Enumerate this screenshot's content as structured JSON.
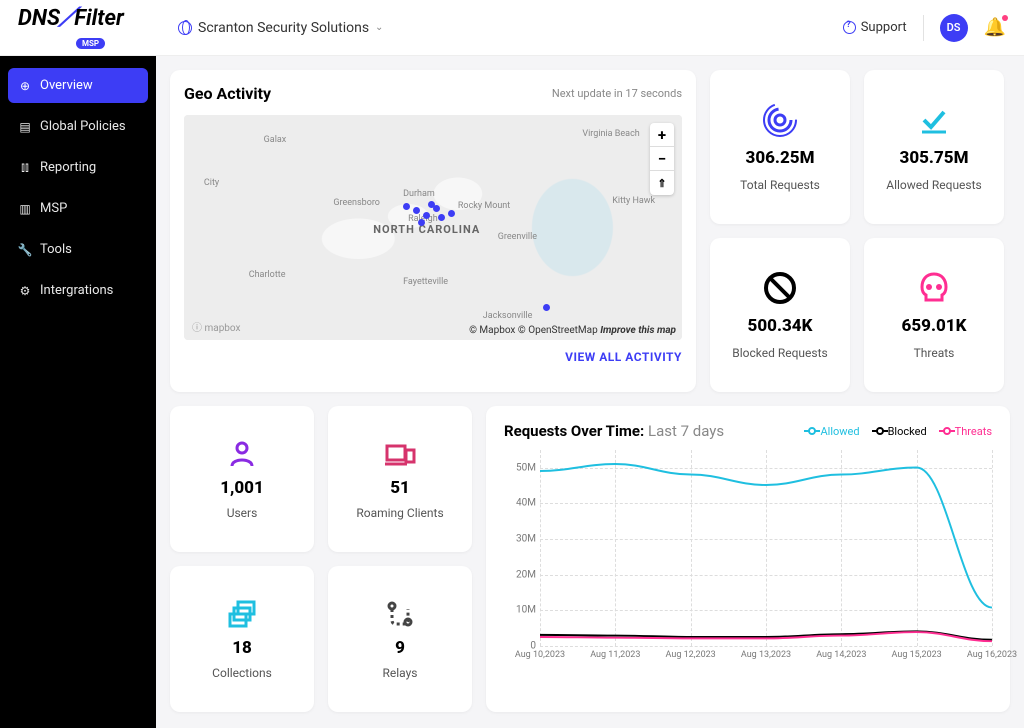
{
  "topbar": {
    "logo_dns": "DNS",
    "logo_filter": "Filter",
    "msp_badge": "MSP",
    "org_name": "Scranton Security Solutions",
    "support": "Support",
    "avatar": "DS"
  },
  "sidebar": {
    "items": [
      {
        "label": "Overview"
      },
      {
        "label": "Global Policies"
      },
      {
        "label": "Reporting"
      },
      {
        "label": "MSP"
      },
      {
        "label": "Tools"
      },
      {
        "label": "Intergrations"
      }
    ]
  },
  "geo": {
    "title": "Geo Activity",
    "update": "Next update in 17 seconds",
    "view_all": "VIEW ALL ACTIVITY",
    "state": "NORTH CAROLINA",
    "cities": [
      "Galax",
      "City",
      "Greensboro",
      "Durham",
      "Raleigh",
      "Rocky Mount",
      "Charlotte",
      "Fayetteville",
      "Greenville",
      "Jacksonville",
      "Virginia Beach",
      "Kitty Hawk"
    ],
    "attribution_mapbox": "© Mapbox",
    "attribution_osm": "© OpenStreetMap",
    "attribution_improve": "Improve this map",
    "mapbox_logo": "ⓘ mapbox"
  },
  "stats": [
    {
      "value": "306.25M",
      "label": "Total Requests",
      "color": "#3d3df5"
    },
    {
      "value": "305.75M",
      "label": "Allowed Requests",
      "color": "#1fbfe0"
    },
    {
      "value": "500.34K",
      "label": "Blocked Requests",
      "color": "#000"
    },
    {
      "value": "659.01K",
      "label": "Threats",
      "color": "#ff2e92"
    }
  ],
  "minis": [
    {
      "value": "1,001",
      "label": "Users",
      "color": "#8a2be2"
    },
    {
      "value": "51",
      "label": "Roaming Clients",
      "color": "#d6336c"
    },
    {
      "value": "18",
      "label": "Collections",
      "color": "#1fbfe0"
    },
    {
      "value": "9",
      "label": "Relays",
      "color": "#444"
    }
  ],
  "chart": {
    "title": "Requests Over Time:",
    "subtitle": "Last 7 days",
    "legend": [
      {
        "name": "Allowed",
        "color": "#1fbfe0"
      },
      {
        "name": "Blocked",
        "color": "#000"
      },
      {
        "name": "Threats",
        "color": "#ff2e92"
      }
    ]
  },
  "chart_data": {
    "type": "line",
    "title": "Requests Over Time: Last 7 days",
    "xlabel": "",
    "ylabel": "",
    "ylim": [
      0,
      55000000
    ],
    "y_ticks": [
      "50M",
      "40M",
      "30M",
      "20M",
      "10M",
      "0"
    ],
    "categories": [
      "Aug 10,2023",
      "Aug 11,2023",
      "Aug 12,2023",
      "Aug 13,2023",
      "Aug 14,2023",
      "Aug 15,2023",
      "Aug 16,2023"
    ],
    "series": [
      {
        "name": "Allowed",
        "color": "#1fbfe0",
        "values": [
          49000000,
          51000000,
          48000000,
          45000000,
          48000000,
          50000000,
          10000000
        ]
      },
      {
        "name": "Blocked",
        "color": "#000",
        "values": [
          2200000,
          2000000,
          1600000,
          1600000,
          2400000,
          3200000,
          800000
        ]
      },
      {
        "name": "Threats",
        "color": "#ff2e92",
        "values": [
          1600000,
          1400000,
          1200000,
          1200000,
          2000000,
          3000000,
          400000
        ]
      }
    ]
  }
}
